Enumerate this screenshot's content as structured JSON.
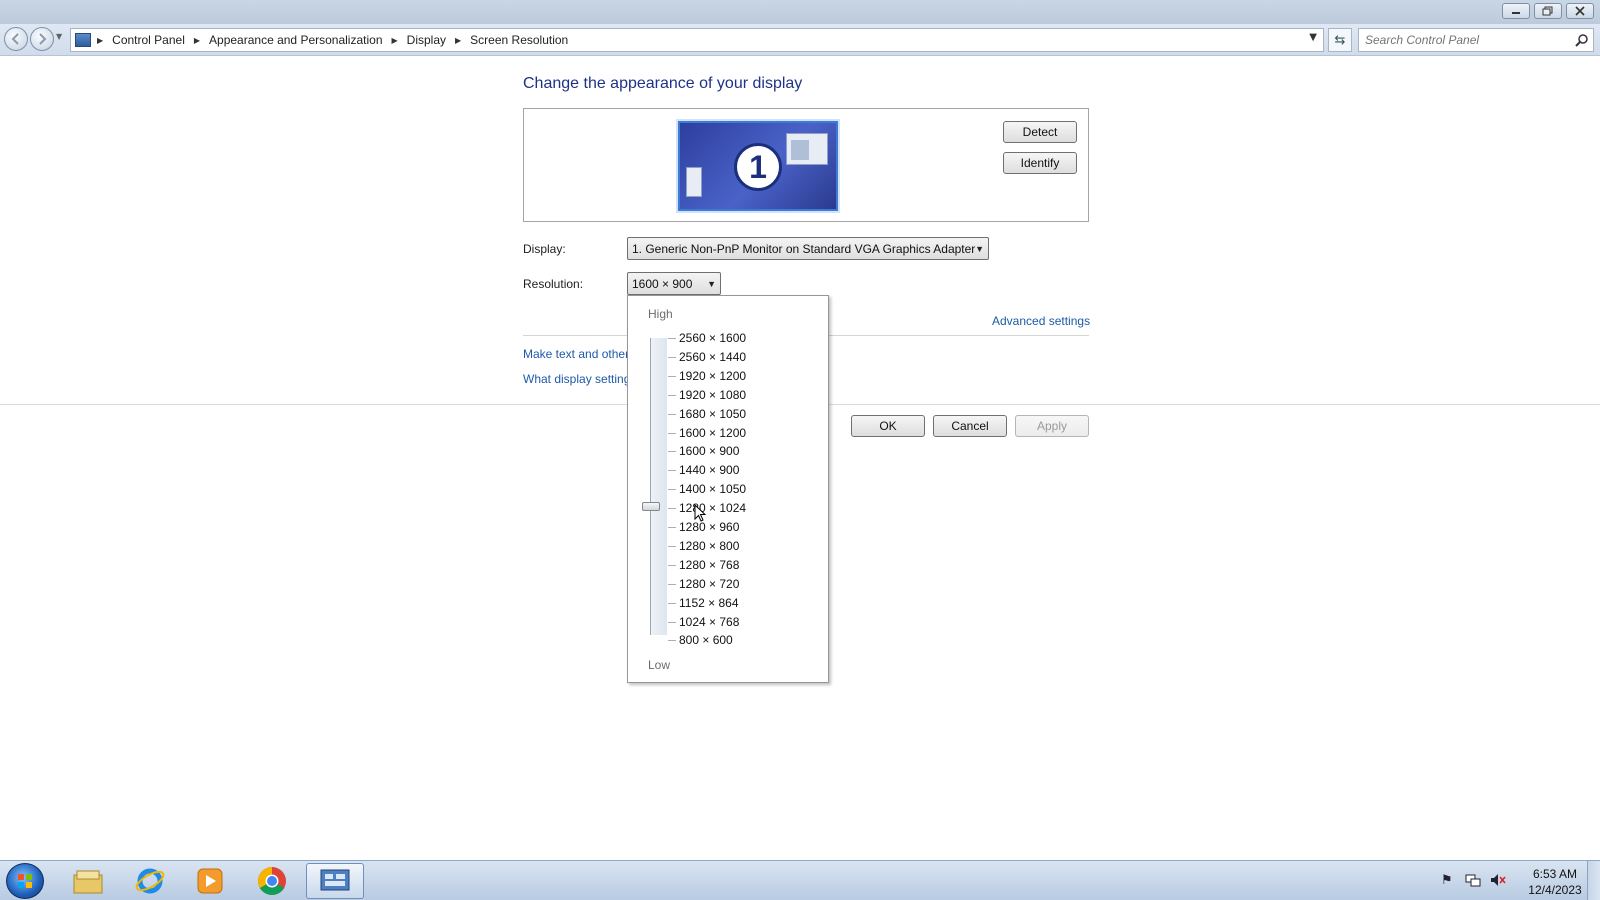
{
  "window": {
    "minimize_icon": "minimize-icon",
    "restore_icon": "restore-icon",
    "close_icon": "close-icon"
  },
  "nav": {
    "breadcrumbs": [
      "Control Panel",
      "Appearance and Personalization",
      "Display",
      "Screen Resolution"
    ],
    "search_placeholder": "Search Control Panel"
  },
  "main": {
    "heading": "Change the appearance of your display",
    "monitor_number": "1",
    "detect_label": "Detect",
    "identify_label": "Identify",
    "display_label": "Display:",
    "display_value": "1. Generic Non-PnP Monitor on Standard VGA Graphics Adapter",
    "resolution_label": "Resolution:",
    "resolution_value": "1600 × 900",
    "advanced_link": "Advanced settings",
    "link_text_size": "Make text and other",
    "link_display_settings": "What display setting",
    "ok_label": "OK",
    "cancel_label": "Cancel",
    "apply_label": "Apply"
  },
  "resolution_dropdown": {
    "high_label": "High",
    "low_label": "Low",
    "selected": "1280 × 1024",
    "options": [
      "2560 × 1600",
      "2560 × 1440",
      "1920 × 1200",
      "1920 × 1080",
      "1680 × 1050",
      "1600 × 1200",
      "1600 × 900",
      "1440 × 900",
      "1400 × 1050",
      "1280 × 1024",
      "1280 × 960",
      "1280 × 800",
      "1280 × 768",
      "1280 × 720",
      "1152 × 864",
      "1024 × 768",
      "800 × 600"
    ]
  },
  "taskbar": {
    "items": [
      "windows-explorer-icon",
      "internet-explorer-icon",
      "media-player-icon",
      "chrome-icon",
      "control-panel-icon"
    ],
    "time": "6:53 AM",
    "date": "12/4/2023"
  },
  "colors": {
    "heading": "#1e3287",
    "link": "#1e5aa8",
    "taskbar": "#b8cbe2"
  }
}
